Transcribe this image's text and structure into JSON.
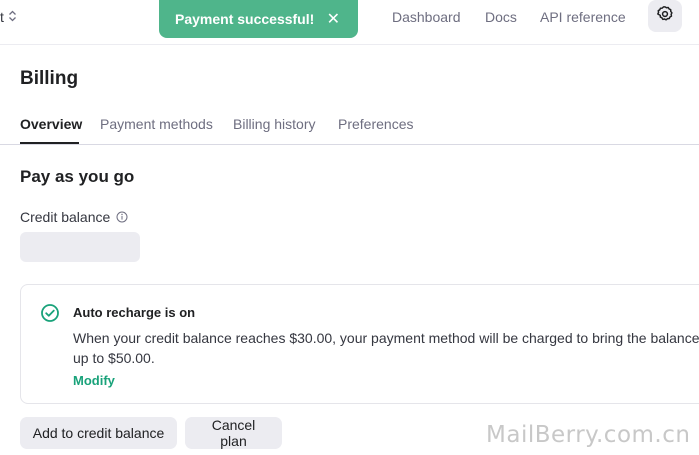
{
  "topbar": {
    "project_fragment": "t",
    "toast": {
      "message": "Payment successful!",
      "close": "✕"
    },
    "nav": [
      "Dashboard",
      "Docs",
      "API reference"
    ]
  },
  "page": {
    "title": "Billing"
  },
  "tabs": [
    {
      "label": "Overview",
      "active": true
    },
    {
      "label": "Payment methods",
      "active": false
    },
    {
      "label": "Billing history",
      "active": false
    },
    {
      "label": "Preferences",
      "active": false
    }
  ],
  "plan": {
    "title": "Pay as you go",
    "credit_label": "Credit balance"
  },
  "auto_recharge": {
    "heading": "Auto recharge is on",
    "description": "When your credit balance reaches $30.00, your payment method will be charged to bring the balance up to $50.00.",
    "modify": "Modify"
  },
  "buttons": {
    "add_credit": "Add to credit balance",
    "cancel": "Cancel plan"
  },
  "watermark": "MailBerry.com.cn",
  "colors": {
    "toast_green": "#4fb58b",
    "accent_green": "#19a27a",
    "button_bg": "#ececf1"
  }
}
